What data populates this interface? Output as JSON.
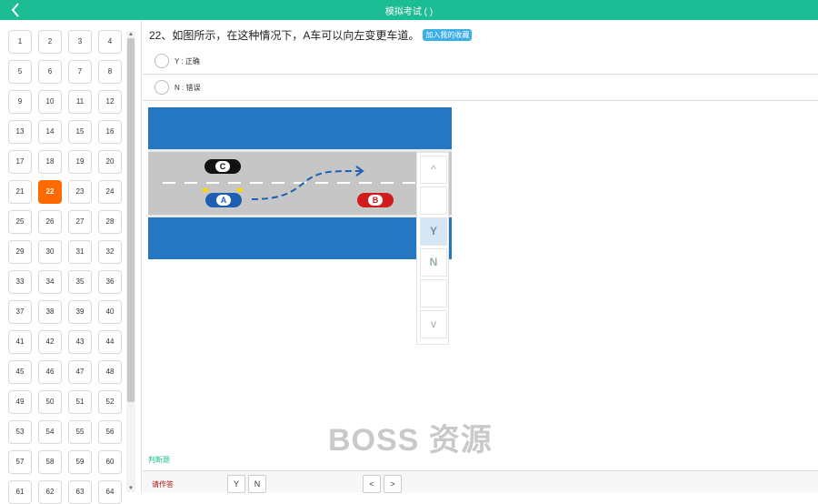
{
  "header": {
    "title": "模拟考试 (  )",
    "back_icon": "chevron-left-icon"
  },
  "question_grid": {
    "numbers": [
      "1",
      "2",
      "3",
      "4",
      "5",
      "6",
      "7",
      "8",
      "9",
      "10",
      "11",
      "12",
      "13",
      "14",
      "15",
      "16",
      "17",
      "18",
      "19",
      "20",
      "21",
      "22",
      "23",
      "24",
      "25",
      "26",
      "27",
      "28",
      "29",
      "30",
      "31",
      "32",
      "33",
      "34",
      "35",
      "36",
      "37",
      "38",
      "39",
      "40",
      "41",
      "42",
      "43",
      "44",
      "45",
      "46",
      "47",
      "48",
      "49",
      "50",
      "51",
      "52",
      "53",
      "54",
      "55",
      "56",
      "57",
      "58",
      "59",
      "60",
      "61",
      "62",
      "63",
      "64"
    ],
    "current": "22"
  },
  "question": {
    "text": "22、如图所示，在这种情况下，A车可以向左变更车道。",
    "favorite_label": "加入我的收藏",
    "options": [
      {
        "label": "Y : 正确"
      },
      {
        "label": "N : 错误"
      }
    ]
  },
  "figure": {
    "car_a": "A",
    "car_b": "B",
    "car_c": "C",
    "colors": {
      "water": "#2577c1",
      "road": "#c8c8c8",
      "car_a": "#1f5fb3",
      "car_b": "#d01c1c",
      "car_c": "#111111",
      "path": "#1f5fb3"
    }
  },
  "answer_panel": {
    "up_label": "^",
    "down_label": "v",
    "options": [
      "",
      "Y",
      "N",
      ""
    ]
  },
  "watermark": "BOSS 资源",
  "judge_link": "判断题",
  "footer": {
    "hint": "请作答",
    "y_label": "Y",
    "n_label": "N",
    "prev_label": "<",
    "next_label": ">"
  },
  "accent": "#1cbc94"
}
